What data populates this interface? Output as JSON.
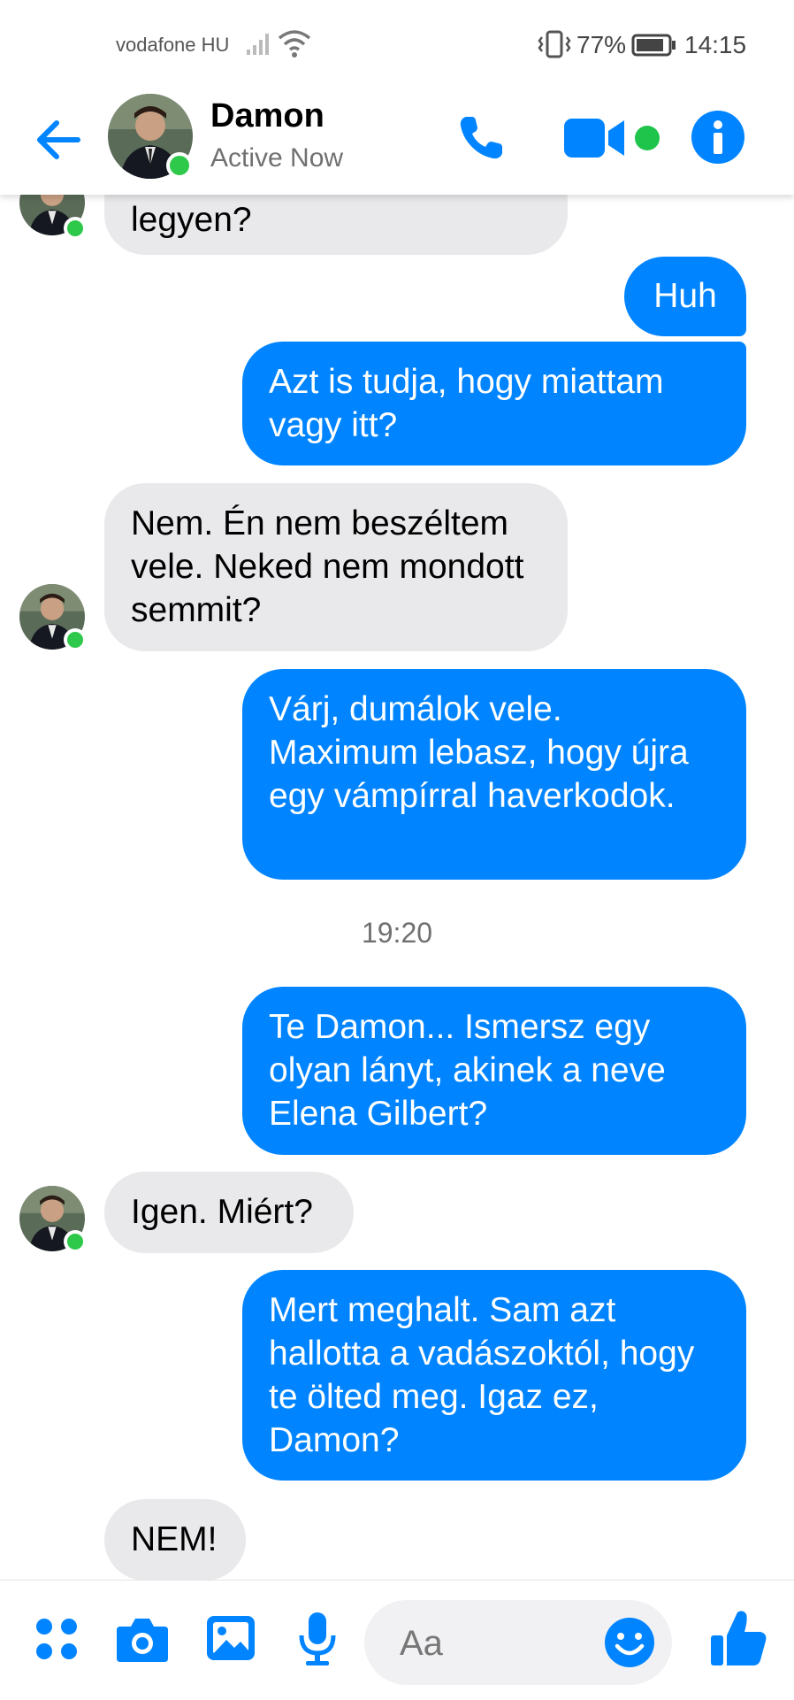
{
  "status_bar": {
    "carrier": "vodafone HU",
    "battery_percent": "77%",
    "time": "14:15",
    "icons": [
      "signal-icon",
      "wifi-icon",
      "vibrate-icon",
      "battery-icon"
    ]
  },
  "header": {
    "name": "Damon",
    "status": "Active Now",
    "icons": [
      "back-arrow-icon",
      "phone-icon",
      "video-camera-icon",
      "info-icon"
    ]
  },
  "messages": [
    {
      "from": "them",
      "text": "legyen?"
    },
    {
      "from": "me",
      "text": "Huh"
    },
    {
      "from": "me",
      "text": "Azt is tudja, hogy miattam vagy itt?"
    },
    {
      "from": "them",
      "text": "Nem. Én nem beszéltem vele. Neked nem mondott semmit?"
    },
    {
      "from": "me",
      "text": "Várj, dumálok vele. Maximum lebasz, hogy újra egy vámpírral haverkodok."
    },
    {
      "timestamp": "19:20"
    },
    {
      "from": "me",
      "text": "Te Damon... Ismersz egy olyan lányt, akinek a neve Elena Gilbert?"
    },
    {
      "from": "them",
      "text": "Igen. Miért?"
    },
    {
      "from": "me",
      "text": "Mert meghalt. Sam azt hallotta a vadászoktól, hogy te ölted meg. Igaz ez, Damon?"
    },
    {
      "from": "them",
      "text": "NEM!"
    }
  ],
  "bottom_bar": {
    "placeholder": "Aa",
    "icons": [
      "apps-icon",
      "camera-icon",
      "image-icon",
      "microphone-icon",
      "emoji-icon",
      "thumbs-up-icon"
    ]
  },
  "colors": {
    "accent": "#0084ff",
    "incoming_bubble": "#e9e9eb",
    "online": "#2ec84a"
  }
}
